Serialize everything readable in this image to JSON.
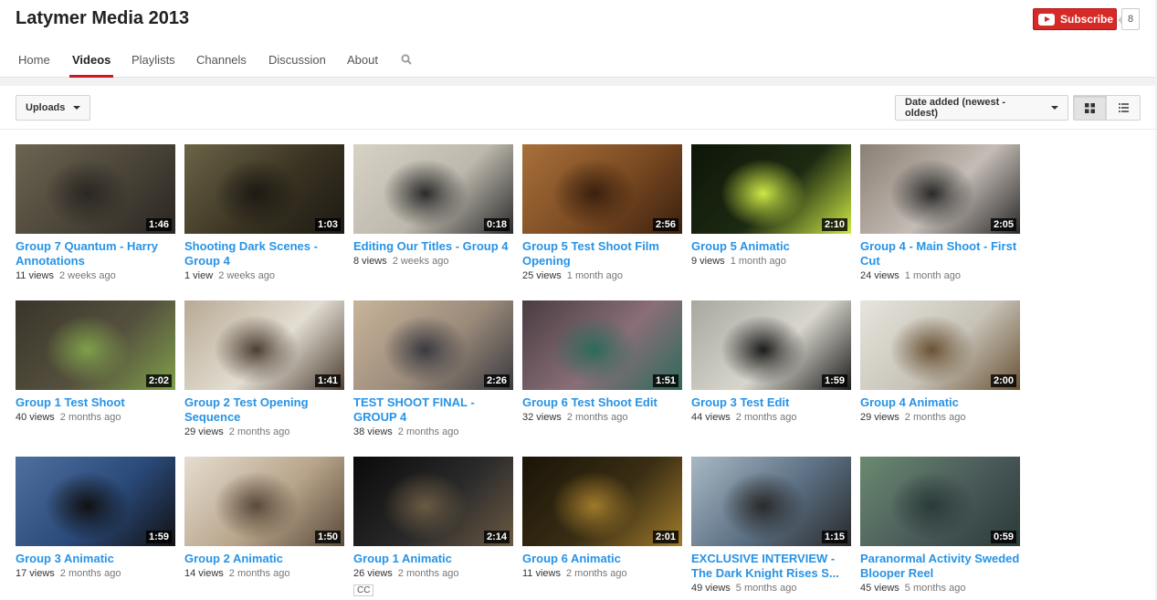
{
  "channel": {
    "title": "Latymer Media 2013",
    "subscribe_label": "Subscribe",
    "subscriber_count": "8"
  },
  "tabs": [
    {
      "label": "Home",
      "active": false
    },
    {
      "label": "Videos",
      "active": true
    },
    {
      "label": "Playlists",
      "active": false
    },
    {
      "label": "Channels",
      "active": false
    },
    {
      "label": "Discussion",
      "active": false
    },
    {
      "label": "About",
      "active": false
    }
  ],
  "toolbar": {
    "uploads_label": "Uploads",
    "sort_label": "Date added (newest - oldest)"
  },
  "colors": {
    "accent": "#cc181e",
    "link": "#2793e6",
    "subscribe": "#d62a27"
  },
  "videos": [
    {
      "title": "Group 7 Quantum - Harry Annotations",
      "views": "11 views",
      "ago": "2 weeks ago",
      "duration": "1:46",
      "thumb": [
        "#4a4438",
        "#2a2622",
        "#6c6452"
      ]
    },
    {
      "title": "Shooting Dark Scenes - Group 4",
      "views": "1 view",
      "ago": "2 weeks ago",
      "duration": "1:03",
      "thumb": [
        "#3a3322",
        "#1d1a14",
        "#6b6447"
      ]
    },
    {
      "title": "Editing Our Titles - Group 4",
      "views": "8 views",
      "ago": "2 weeks ago",
      "duration": "0:18",
      "thumb": [
        "#bdb8ad",
        "#2b2b2b",
        "#d7d2c4"
      ]
    },
    {
      "title": "Group 5 Test Shoot Film Opening",
      "views": "25 views",
      "ago": "1 month ago",
      "duration": "2:56",
      "thumb": [
        "#7a4a22",
        "#3a200e",
        "#a8703a"
      ]
    },
    {
      "title": "Group 5 Animatic",
      "views": "9 views",
      "ago": "1 month ago",
      "duration": "2:10",
      "thumb": [
        "#1c2a12",
        "#cde846",
        "#0e1508"
      ]
    },
    {
      "title": "Group 4 - Main Shoot - First Cut",
      "views": "24 views",
      "ago": "1 month ago",
      "duration": "2:05",
      "thumb": [
        "#c4bcb5",
        "#2a2a2a",
        "#8a7f73"
      ]
    },
    {
      "title": "Group 1 Test Shoot",
      "views": "40 views",
      "ago": "2 months ago",
      "duration": "2:02",
      "thumb": [
        "#55503e",
        "#7fa04a",
        "#3a352a"
      ]
    },
    {
      "title": "Group 2 Test Opening Sequence",
      "views": "29 views",
      "ago": "2 months ago",
      "duration": "1:41",
      "thumb": [
        "#e3ded2",
        "#4d3e33",
        "#b8aa95"
      ]
    },
    {
      "title": "TEST SHOOT FINAL - GROUP 4",
      "views": "38 views",
      "ago": "2 months ago",
      "duration": "2:26",
      "thumb": [
        "#9a8a7a",
        "#3a3a40",
        "#c8b49a"
      ]
    },
    {
      "title": "Group 6 Test Shoot Edit",
      "views": "32 views",
      "ago": "2 months ago",
      "duration": "1:51",
      "thumb": [
        "#8a6e78",
        "#2d6a5a",
        "#4a3d42"
      ]
    },
    {
      "title": "Group 3 Test Edit",
      "views": "44 views",
      "ago": "2 months ago",
      "duration": "1:59",
      "thumb": [
        "#d8d6cc",
        "#1c1c1c",
        "#a8a8a0"
      ]
    },
    {
      "title": "Group 4 Animatic",
      "views": "29 views",
      "ago": "2 months ago",
      "duration": "2:00",
      "thumb": [
        "#c7c3b8",
        "#6a5234",
        "#e6e4dc"
      ]
    },
    {
      "title": "Group 3 Animatic",
      "views": "17 views",
      "ago": "2 months ago",
      "duration": "1:59",
      "thumb": [
        "#2a4a7a",
        "#111111",
        "#4f6fa0"
      ]
    },
    {
      "title": "Group 2 Animatic",
      "views": "14 views",
      "ago": "2 months ago",
      "duration": "1:50",
      "thumb": [
        "#b7a48a",
        "#5a4a3a",
        "#e6ddd0"
      ]
    },
    {
      "title": "Group 1 Animatic",
      "views": "26 views",
      "ago": "2 months ago",
      "duration": "2:14",
      "thumb": [
        "#2a2a2a",
        "#6a5a42",
        "#0a0a0a"
      ],
      "cc": "CC"
    },
    {
      "title": "Group 6 Animatic",
      "views": "11 views",
      "ago": "2 months ago",
      "duration": "2:01",
      "thumb": [
        "#3a2e14",
        "#a07a2a",
        "#1a1408"
      ]
    },
    {
      "title": "EXCLUSIVE INTERVIEW - The Dark Knight Rises S...",
      "views": "49 views",
      "ago": "5 months ago",
      "duration": "1:15",
      "thumb": [
        "#5a6e82",
        "#2a2a2a",
        "#a8b8c4"
      ]
    },
    {
      "title": "Paranormal Activity Sweded Blooper Reel",
      "views": "45 views",
      "ago": "5 months ago",
      "duration": "0:59",
      "thumb": [
        "#4a5a5a",
        "#2a3a38",
        "#6a8a70"
      ]
    }
  ]
}
